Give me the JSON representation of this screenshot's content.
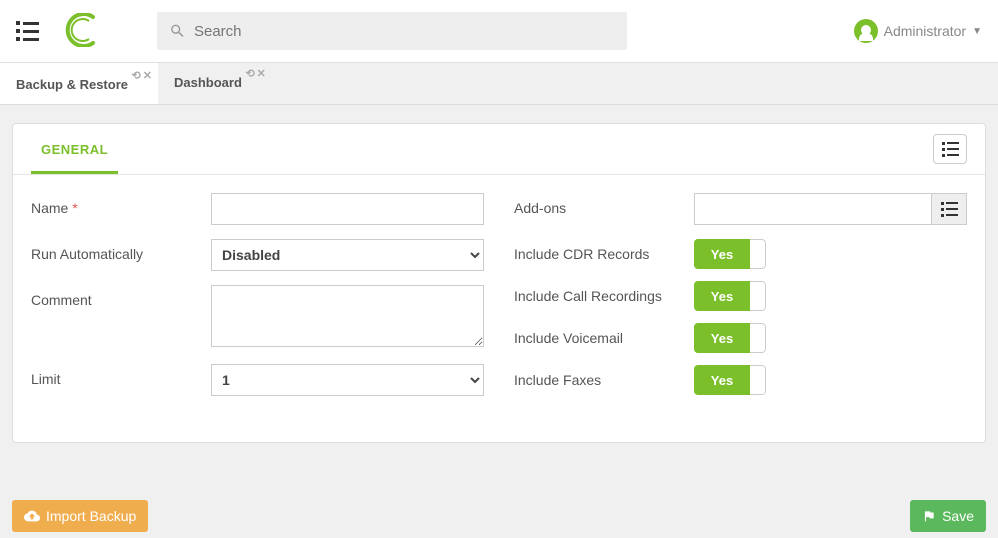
{
  "header": {
    "search_placeholder": "Search",
    "user_name": "Administrator"
  },
  "tabs": {
    "backup_restore": "Backup & Restore",
    "dashboard": "Dashboard"
  },
  "card": {
    "tab_general": "GENERAL"
  },
  "form": {
    "name_label": "Name",
    "run_auto_label": "Run Automatically",
    "run_auto_value": "Disabled",
    "comment_label": "Comment",
    "limit_label": "Limit",
    "limit_value": "1",
    "addons_label": "Add-ons",
    "inc_cdr_label": "Include CDR Records",
    "inc_callrec_label": "Include Call Recordings",
    "inc_vm_label": "Include Voicemail",
    "inc_fax_label": "Include Faxes",
    "toggle_yes": "Yes"
  },
  "footer": {
    "import_label": "Import Backup",
    "save_label": "Save"
  }
}
